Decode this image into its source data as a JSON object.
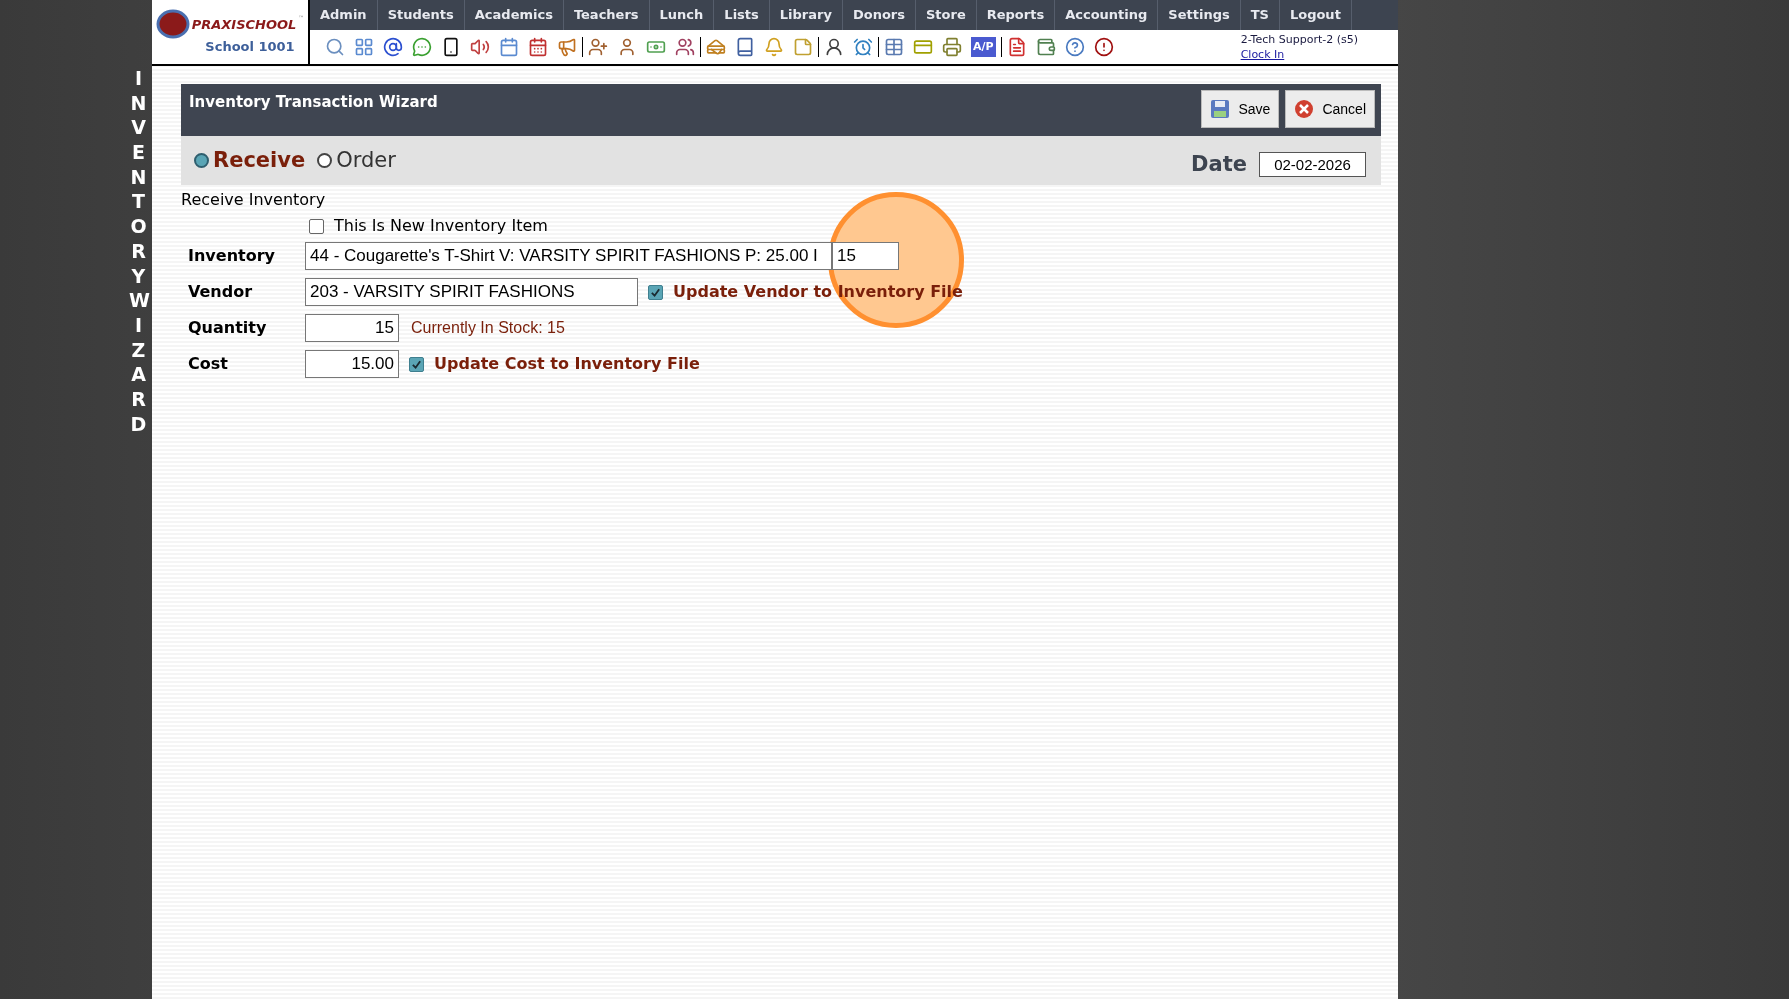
{
  "sidebar_label": "INVENTORY WIZARD",
  "logo": {
    "name": "PRAXISCHOOL",
    "mark": "™",
    "school": "School 1001"
  },
  "nav": [
    "Admin",
    "Students",
    "Academics",
    "Teachers",
    "Lunch",
    "Lists",
    "Library",
    "Donors",
    "Store",
    "Reports",
    "Accounting",
    "Settings",
    "TS",
    "Logout"
  ],
  "toolbar": {
    "ap_label": "A/P"
  },
  "user": {
    "name": "2-Tech Support-2 (s5)",
    "clock_link": "Clock In"
  },
  "wizard": {
    "title": "Inventory Transaction Wizard",
    "buttons": [
      {
        "kind": "save",
        "label": "Save"
      },
      {
        "kind": "cancel",
        "label": "Cancel"
      }
    ],
    "modes": [
      {
        "label": "Receive",
        "selected": true
      },
      {
        "label": "Order",
        "selected": false
      }
    ],
    "date": {
      "label": "Date",
      "value": "02-02-2026"
    },
    "section": "Receive Inventory",
    "new_item": {
      "label": "This Is New Inventory Item",
      "checked": false
    },
    "fields": [
      {
        "kind": "inventory",
        "label": "Inventory",
        "value": "44 - Cougarette's T-Shirt V: VARSITY SPIRIT FASHIONS P: 25.00 I",
        "extra": "15"
      },
      {
        "kind": "vendor",
        "label": "Vendor",
        "value": "203 - VARSITY SPIRIT FASHIONS",
        "update": {
          "label": "Update Vendor to Inventory File",
          "checked": true
        }
      },
      {
        "kind": "quantity",
        "label": "Quantity",
        "value": "15",
        "note": "Currently In Stock: 15"
      },
      {
        "kind": "cost",
        "label": "Cost",
        "value": "15.00",
        "update": {
          "label": "Update Cost to Inventory File",
          "checked": true
        }
      }
    ]
  },
  "click_highlight": true
}
